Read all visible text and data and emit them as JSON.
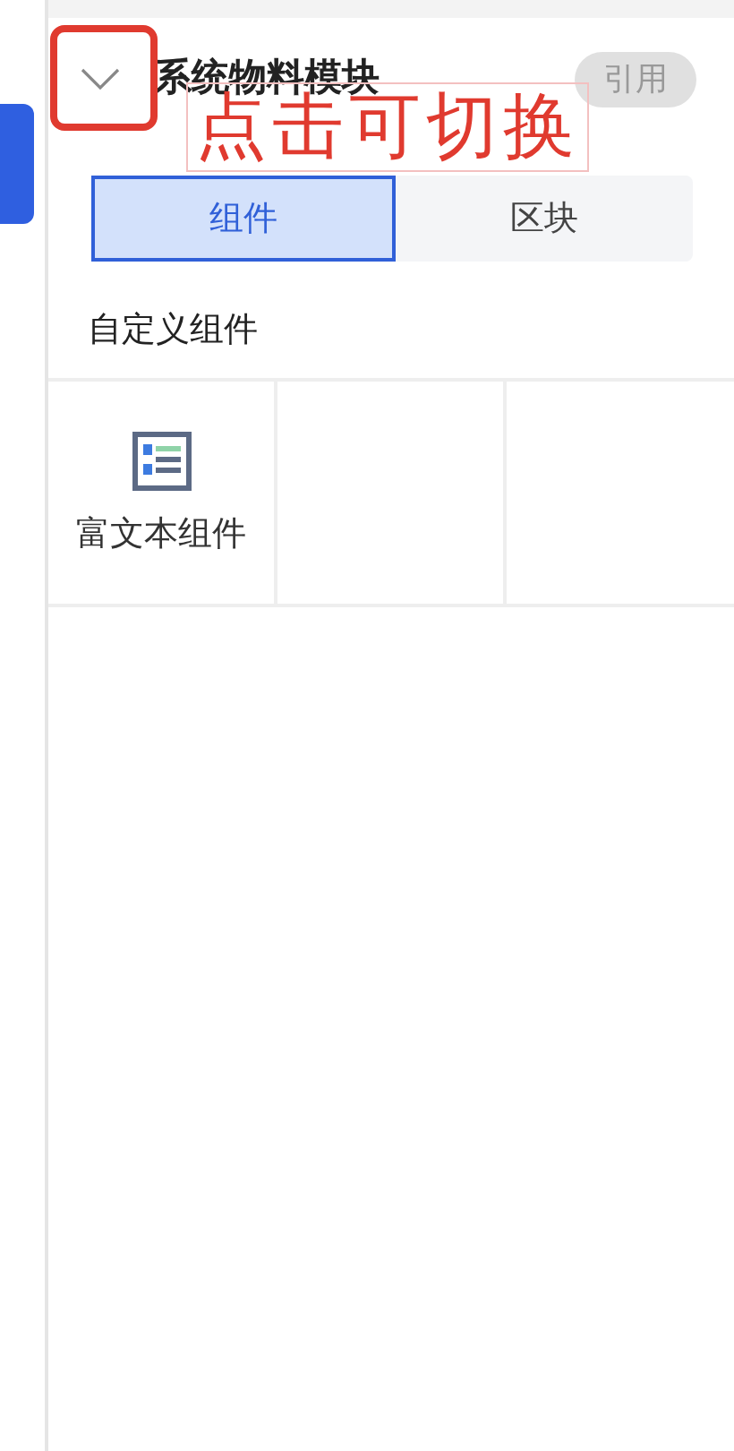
{
  "panel": {
    "title": "系统物料模块",
    "badge": "引用"
  },
  "annotation": {
    "text": "点击可切换"
  },
  "tabs": [
    {
      "label": "组件",
      "selected": true
    },
    {
      "label": "区块",
      "selected": false
    }
  ],
  "section": {
    "title": "自定义组件"
  },
  "components": [
    {
      "label": "富文本组件"
    }
  ]
}
